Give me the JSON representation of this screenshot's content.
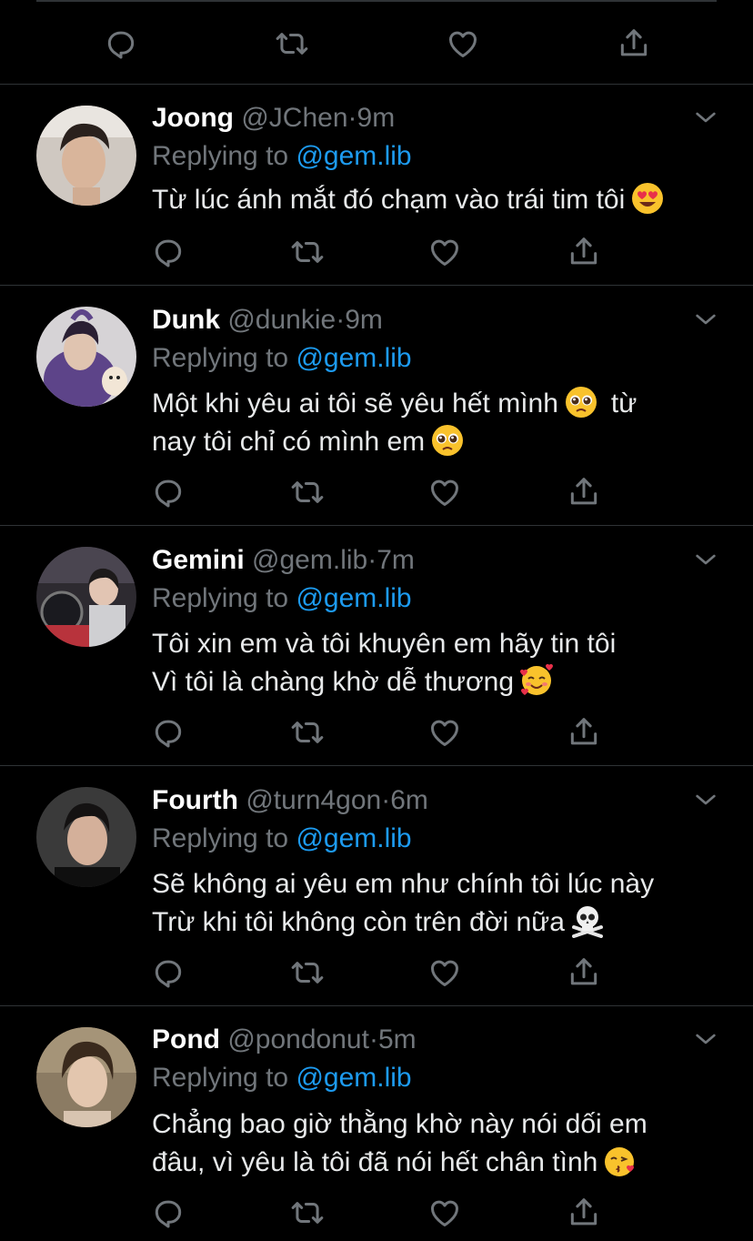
{
  "top_actions": {
    "reply_icon": "reply-icon",
    "retweet_icon": "retweet-icon",
    "like_icon": "like-icon",
    "share_icon": "share-icon"
  },
  "replies": [
    {
      "name": "Joong",
      "handle": "@JChen",
      "separator": "·",
      "time": "9m",
      "replying_prefix": "Replying to",
      "replying_to": "@gem.lib",
      "lines": [
        "Từ lúc ánh mắt đó chạm vào trái tim tôi"
      ],
      "emoji": "heart-eyes-emoji",
      "avatar_color": "#c9c2bb"
    },
    {
      "name": "Dunk",
      "handle": "@dunkie",
      "separator": "·",
      "time": "9m",
      "replying_prefix": "Replying to",
      "replying_to": "@gem.lib",
      "lines": [
        "Một khi yêu ai tôi sẽ yêu hết mình",
        "nay tôi chỉ có mình em"
      ],
      "line1_tail": "từ",
      "emoji": "pleading-face-emoji",
      "avatar_color": "#6b4f94"
    },
    {
      "name": "Gemini",
      "handle": "@gem.lib",
      "separator": "·",
      "time": "7m",
      "replying_prefix": "Replying to",
      "replying_to": "@gem.lib",
      "lines": [
        "Tôi xin em và tôi khuyên em hãy tin tôi",
        "Vì tôi là chàng khờ dễ thương"
      ],
      "emoji": "smiling-face-with-hearts-emoji",
      "avatar_color": "#3a2e33"
    },
    {
      "name": "Fourth",
      "handle": "@turn4gon",
      "separator": "·",
      "time": "6m",
      "replying_prefix": "Replying to",
      "replying_to": "@gem.lib",
      "lines": [
        "Sẽ không ai yêu em như chính tôi lúc này",
        "Trừ khi tôi không còn trên đời nữa"
      ],
      "emoji": "skull-crossbones-emoji",
      "avatar_color": "#2b2b2b"
    },
    {
      "name": "Pond",
      "handle": "@pondonut",
      "separator": "·",
      "time": "5m",
      "replying_prefix": "Replying to",
      "replying_to": "@gem.lib",
      "lines": [
        "Chẳng bao giờ thằng khờ này nói dối em",
        "đâu, vì yêu là tôi đã nói hết chân tình"
      ],
      "emoji": "kissing-heart-emoji",
      "avatar_color": "#8a7a5e"
    }
  ],
  "colors": {
    "background": "#000000",
    "primary_text": "#e7e9ea",
    "secondary_text": "#71767b",
    "link": "#1d9bf0",
    "divider": "#2f3336"
  }
}
